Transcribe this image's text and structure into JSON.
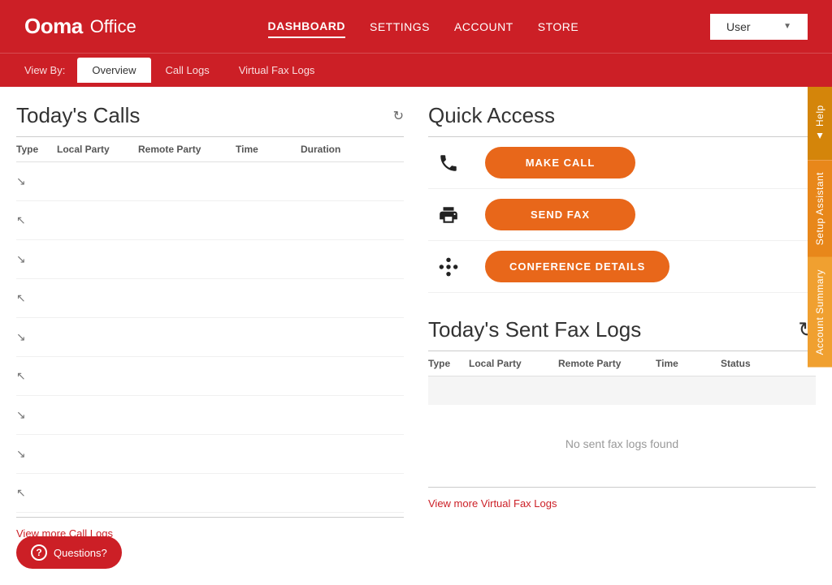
{
  "app": {
    "logo_brand": "Ooma",
    "logo_product": "Office"
  },
  "header": {
    "nav_items": [
      {
        "label": "DASHBOARD",
        "active": true
      },
      {
        "label": "SETTINGS",
        "active": false
      },
      {
        "label": "ACCOUNT",
        "active": false
      },
      {
        "label": "STORE",
        "active": false
      }
    ],
    "user_label": "User"
  },
  "sub_nav": {
    "view_by_label": "View By:",
    "tabs": [
      {
        "label": "Overview",
        "active": true
      },
      {
        "label": "Call Logs",
        "active": false
      },
      {
        "label": "Virtual Fax Logs",
        "active": false
      }
    ]
  },
  "todays_calls": {
    "title": "Today's Calls",
    "columns": [
      "Type",
      "Local Party",
      "Remote Party",
      "Time",
      "Duration"
    ],
    "rows": [
      {
        "type": "outbound"
      },
      {
        "type": "inbound"
      },
      {
        "type": "outbound"
      },
      {
        "type": "inbound"
      },
      {
        "type": "outbound"
      },
      {
        "type": "inbound"
      },
      {
        "type": "outbound"
      },
      {
        "type": "outbound"
      },
      {
        "type": "inbound"
      }
    ],
    "view_more_label": "View more Call Logs"
  },
  "quick_access": {
    "title": "Quick Access",
    "items": [
      {
        "icon": "phone",
        "button_label": "MAKE CALL"
      },
      {
        "icon": "fax",
        "button_label": "SEND FAX"
      },
      {
        "icon": "conference",
        "button_label": "CONFERENCE DETAILS"
      }
    ]
  },
  "todays_fax": {
    "title": "Today's Sent Fax Logs",
    "columns": [
      "Type",
      "Local Party",
      "Remote Party",
      "Time",
      "Status"
    ],
    "no_data_message": "No sent fax logs found",
    "view_more_label": "View more Virtual Fax Logs"
  },
  "side_tabs": [
    {
      "label": "Help",
      "arrow": "▲"
    },
    {
      "label": "Setup Assistant"
    },
    {
      "label": "Account Summary"
    }
  ],
  "questions_btn": {
    "label": "Questions?"
  }
}
